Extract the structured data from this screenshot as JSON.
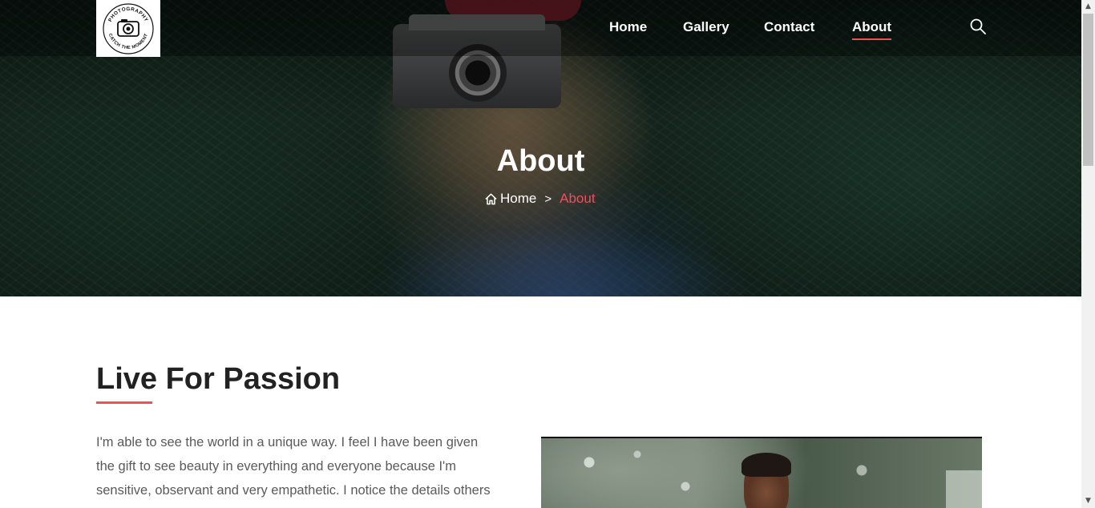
{
  "logo": {
    "ring_top": "PHOTOGRAPHY",
    "ring_bottom": "CATCH THE MOMENT",
    "icon": "camera-icon"
  },
  "nav": {
    "items": [
      {
        "label": "Home"
      },
      {
        "label": "Gallery"
      },
      {
        "label": "Contact"
      },
      {
        "label": "About",
        "active": true
      }
    ],
    "search_icon": "search-icon"
  },
  "hero": {
    "title": "About",
    "breadcrumb": {
      "home": "Home",
      "separator": ">",
      "current": "About",
      "home_icon": "home-icon"
    }
  },
  "content": {
    "heading": "Live For Passion",
    "paragraph_lines": [
      "I'm able to see the world in a unique way. I feel I have been given",
      "the gift to see beauty in everything and everyone because I'm",
      "sensitive, observant and very empathetic. I notice the details others"
    ]
  },
  "colors": {
    "accent": "#ef4f5a",
    "text": "#222222",
    "body_text": "#5a5a5a"
  }
}
